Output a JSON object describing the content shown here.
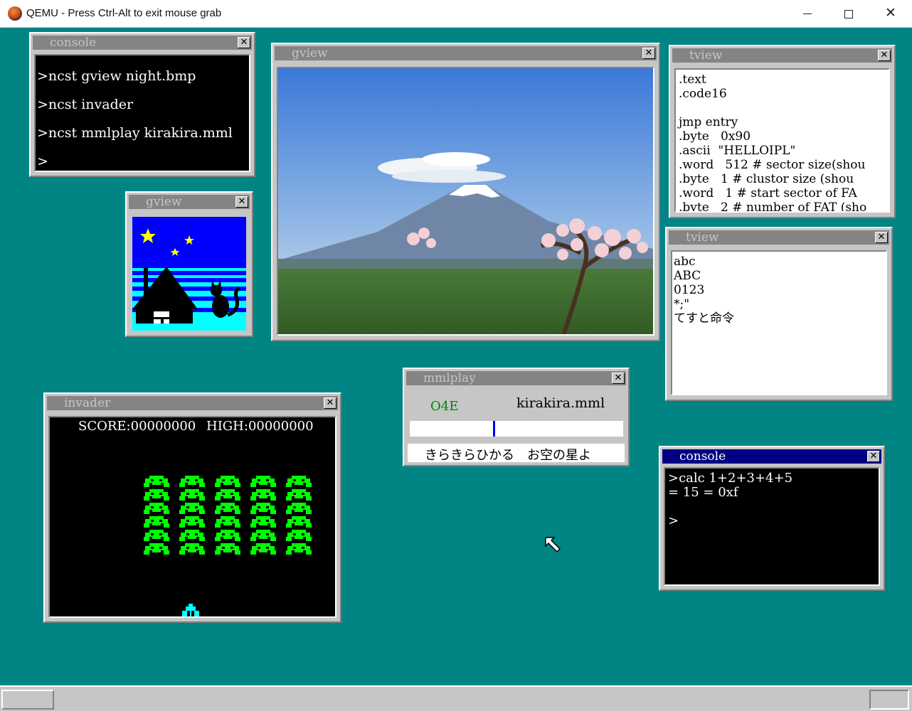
{
  "host": {
    "title": "QEMU - Press Ctrl-Alt to exit mouse grab",
    "close_glyph": "✕"
  },
  "console1": {
    "title": "console",
    "lines": [
      ">ncst gview night.bmp",
      ">ncst invader",
      ">ncst mmlplay kirakira.mml",
      ">"
    ]
  },
  "gview_small": {
    "title": "gview"
  },
  "gview_photo": {
    "title": "gview"
  },
  "tview1": {
    "title": "tview",
    "lines": [
      ".text",
      ".code16",
      "",
      "jmp entry",
      ".byte   0x90",
      ".ascii  \"HELLOIPL\"",
      ".word   512 # sector size(shou",
      ".byte   1 # clustor size (shou",
      ".word   1 # start sector of FA",
      ".byte   2 # number of FAT (sho"
    ]
  },
  "tview2": {
    "title": "tview",
    "lines": [
      "abc",
      "ABC",
      "0123",
      "*;\"",
      "てすと命令"
    ]
  },
  "invader": {
    "title": "invader",
    "score": "SCORE:00000000",
    "high": "HIGH:00000000",
    "alien_color": "#00ff00",
    "ship_color": "#00ffff"
  },
  "mmlplay": {
    "title": "mmlplay",
    "note": "O4E",
    "file": "kirakira.mml",
    "progress": 0.39,
    "lyrics": "きらきらひかる　お空の星よ"
  },
  "console2": {
    "title": "console",
    "lines": [
      ">calc 1+2+3+4+5",
      "= 15 = 0xf",
      "",
      ">"
    ]
  },
  "colors": {
    "desktop": "#008484",
    "active_title": "#000084",
    "inactive_title": "#848484"
  },
  "icons": [
    "app-icon",
    "close-icon",
    "minimize-icon",
    "maximize-icon",
    "mouse-cursor-icon"
  ]
}
